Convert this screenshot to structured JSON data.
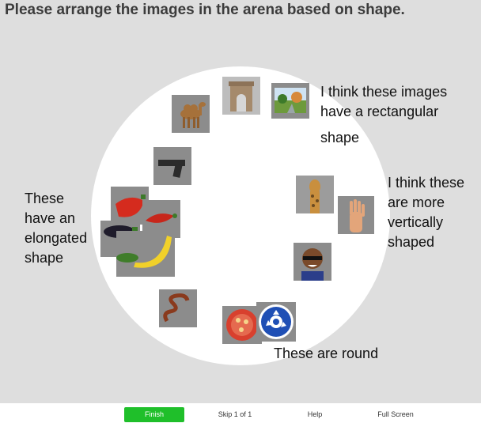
{
  "instruction": "Please arrange the images in the arena based on shape.",
  "annotations": {
    "rectangular_line1": "I think these images",
    "rectangular_line2": "have a rectangular",
    "rectangular_line3": "shape",
    "vertical_line1": "I think these",
    "vertical_line2": "are more",
    "vertical_line3": "vertically",
    "vertical_line4": "shaped",
    "elongated_line1": "These",
    "elongated_line2": "have an",
    "elongated_line3": "elongated",
    "elongated_line4": "shape",
    "round": "These are round"
  },
  "images": [
    "camel",
    "arch-monument",
    "landscape",
    "pistol",
    "giraffe",
    "hand",
    "red-pepper",
    "chili-pepper",
    "eggplant",
    "banana",
    "cucumber",
    "person-with-sunglasses",
    "snake",
    "tomato-slice",
    "roundabout-sign"
  ],
  "footer": {
    "finish": "Finish",
    "skip": "Skip 1 of 1",
    "help": "Help",
    "fullscreen": "Full Screen"
  },
  "colors": {
    "background": "#dedede",
    "arena": "#ffffff",
    "finish_button": "#1fbf2a",
    "tile": "#8a8a8a"
  }
}
